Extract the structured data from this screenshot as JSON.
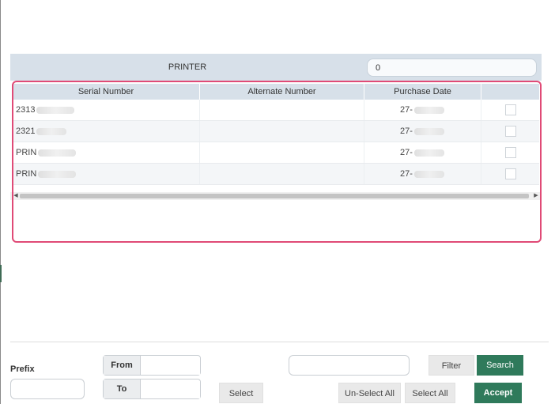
{
  "printer_panel": {
    "title": "PRINTER",
    "count_value": "0"
  },
  "grid": {
    "columns": [
      "Serial Number",
      "Alternate Number",
      "Purchase Date",
      ""
    ],
    "rows": [
      {
        "serial": "2313",
        "alternate": "",
        "purchase_date": "27-",
        "selected": false
      },
      {
        "serial": "2321",
        "alternate": "",
        "purchase_date": "27-",
        "selected": false
      },
      {
        "serial": "PRIN",
        "alternate": "",
        "purchase_date": "27-",
        "selected": false
      },
      {
        "serial": "PRIN",
        "alternate": "",
        "purchase_date": "27-",
        "selected": false
      }
    ]
  },
  "footer": {
    "prefix_label": "Prefix",
    "prefix_value": "",
    "from_label": "From",
    "from_value": "",
    "to_label": "To",
    "to_value": "",
    "select_label": "Select",
    "filter_value": "",
    "filter_label": "Filter",
    "search_label": "Search",
    "unselect_all_label": "Un-Select All",
    "select_all_label": "Select All",
    "accept_label": "Accept"
  },
  "colors": {
    "accent_green": "#2f7a5b",
    "highlight_pink": "#e04a76",
    "header_blue_grey": "#d7e0e9"
  }
}
